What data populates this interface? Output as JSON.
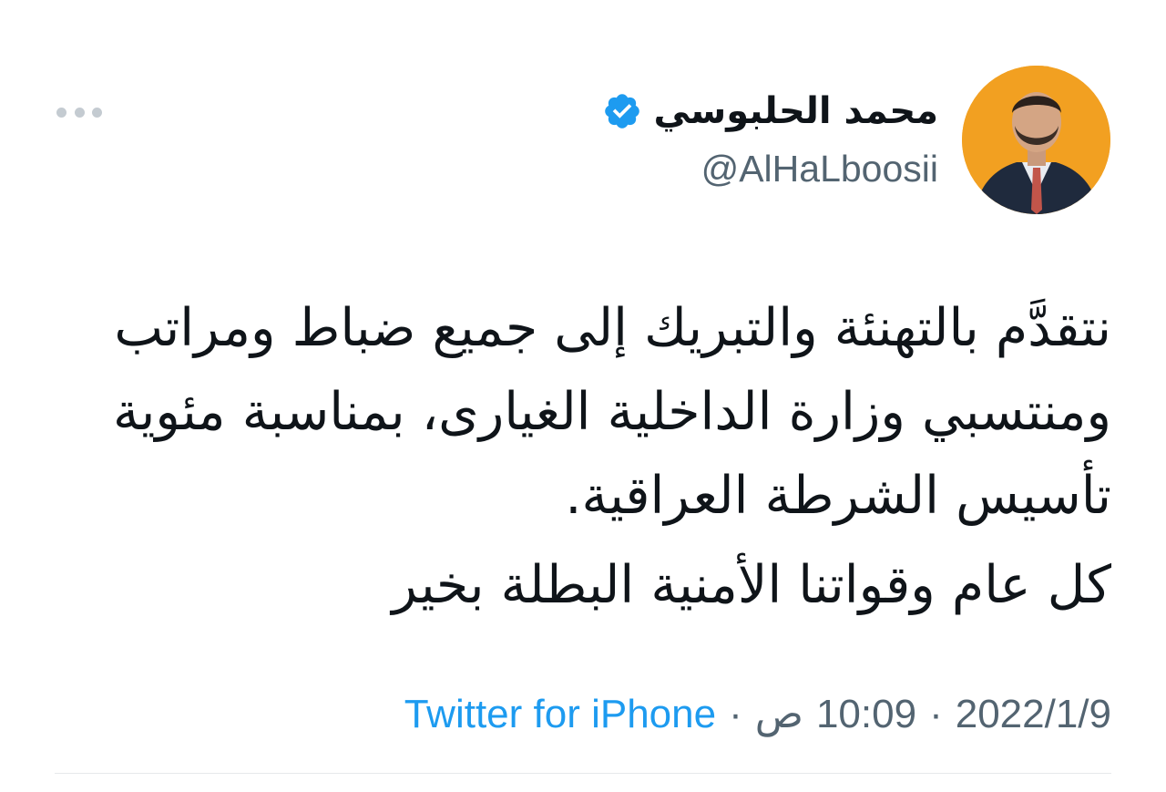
{
  "tweet": {
    "author": {
      "display_name": "محمد الحلبوسي",
      "handle": "@AlHaLboosii",
      "verified": true,
      "avatar_bg": "#f2a021"
    },
    "text_paragraphs": [
      "نتقدَّم بالتهنئة والتبريك إلى جميع ضباط ومراتب ومنتسبي وزارة الداخلية الغيارى، بمناسبة مئوية تأسيس الشرطة العراقية.",
      "كل عام وقواتنا الأمنية البطلة بخير"
    ],
    "meta": {
      "date": "2022/1/9",
      "time": "10:09",
      "period": "ص",
      "separator": "·",
      "source": "Twitter for iPhone"
    }
  },
  "colors": {
    "text": "#0f1419",
    "secondary": "#536471",
    "link": "#1d9bf0",
    "verified_badge": "#1d9bf0",
    "more_dots": "#c4cbd1",
    "divider": "#e6e9eb"
  },
  "icons": {
    "more": "more-horizontal-icon",
    "verified": "verified-badge-icon"
  }
}
